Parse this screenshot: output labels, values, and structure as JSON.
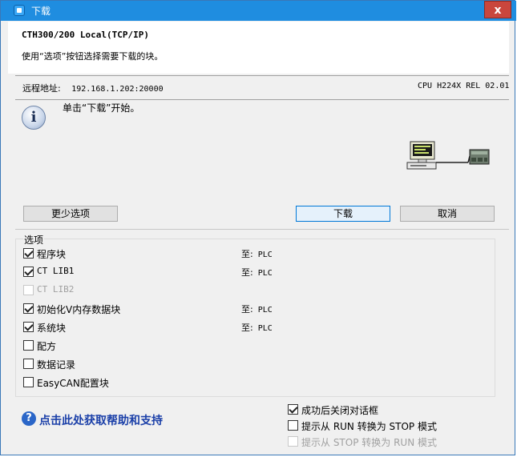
{
  "window": {
    "title": "下载",
    "close_glyph": "x"
  },
  "header": {
    "device": "CTH300/200 Local(TCP/IP)",
    "description": "使用“选项”按钮选择需要下载的块。"
  },
  "connection": {
    "remote_label": "远程地址:",
    "remote_value": "192.168.1.202:20000",
    "cpu_info": "CPU H224X REL 02.01"
  },
  "status": {
    "instruction": "单击“下载”开始。"
  },
  "buttons": {
    "fewer_options": "更少选项",
    "download": "下载",
    "cancel": "取消"
  },
  "options": {
    "legend": "选项",
    "to_label": "至:",
    "items": [
      {
        "label": "程序块",
        "checked": true,
        "disabled": false,
        "target": "PLC"
      },
      {
        "label": "CT LIB1",
        "checked": true,
        "disabled": false,
        "target": "PLC"
      },
      {
        "label": "CT LIB2",
        "checked": false,
        "disabled": true,
        "target": ""
      },
      {
        "label": "初始化V内存数据块",
        "checked": true,
        "disabled": false,
        "target": "PLC"
      },
      {
        "label": "系统块",
        "checked": true,
        "disabled": false,
        "target": "PLC"
      },
      {
        "label": "配方",
        "checked": false,
        "disabled": false,
        "target": ""
      },
      {
        "label": "数据记录",
        "checked": false,
        "disabled": false,
        "target": ""
      },
      {
        "label": "EasyCAN配置块",
        "checked": false,
        "disabled": false,
        "target": ""
      }
    ]
  },
  "post_download": [
    {
      "label": "成功后关闭对话框",
      "checked": true,
      "disabled": false
    },
    {
      "label": "提示从 RUN 转换为 STOP 模式",
      "checked": false,
      "disabled": false
    },
    {
      "label": "提示从 STOP 转换为 RUN 模式",
      "checked": false,
      "disabled": true
    }
  ],
  "help": {
    "link_text": "点击此处获取帮助和支持",
    "icon_glyph": "?"
  },
  "icons": {
    "info": "i"
  }
}
